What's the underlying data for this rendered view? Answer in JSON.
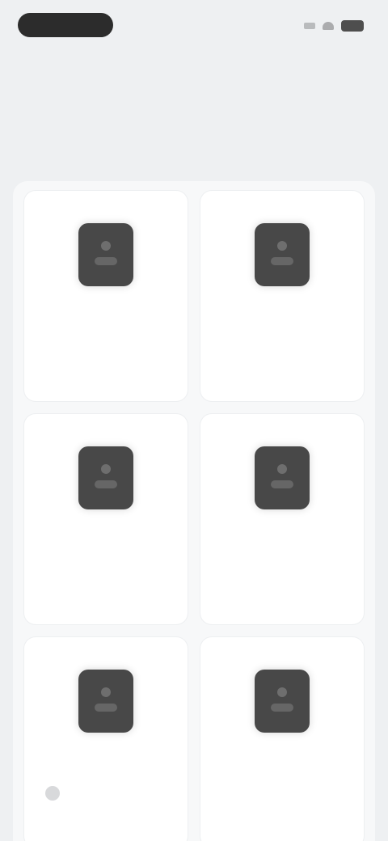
{
  "status_bar": {
    "pill_label": "",
    "icons": [
      "signal-icon",
      "wifi-icon",
      "battery-icon"
    ]
  },
  "page": {
    "title": ""
  },
  "categories": [
    {
      "label": "",
      "subtitle": ""
    },
    {
      "label": "",
      "subtitle": ""
    },
    {
      "label": "",
      "subtitle": ""
    },
    {
      "label": "",
      "subtitle": ""
    },
    {
      "label": "",
      "subtitle": ""
    },
    {
      "label": "",
      "subtitle": ""
    }
  ],
  "colors": {
    "background": "#eef0f2",
    "card": "#ffffff",
    "icon_tile": "#484848",
    "status_pill": "#2c2c2c"
  }
}
